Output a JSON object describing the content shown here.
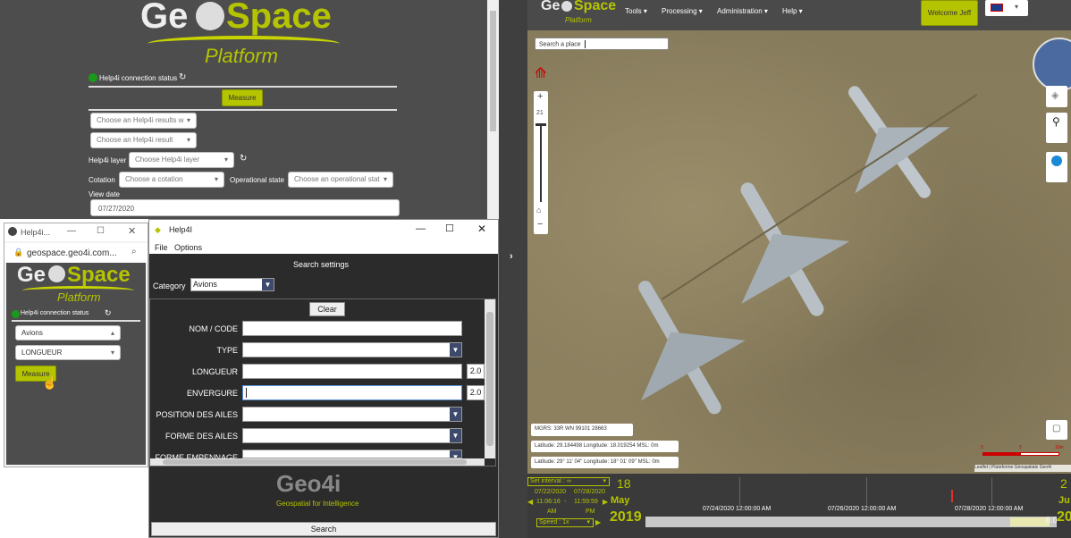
{
  "left_panel": {
    "logo_geo": "Ge",
    "logo_space": "Space",
    "logo_platform": "Platform",
    "connection_status": "Help4i connection status",
    "measure_label": "Measure",
    "results_select": "Choose an Help4i results w",
    "result_select": "Choose an Help4i result",
    "layer_label": "Help4i layer",
    "layer_select": "Choose Help4i layer",
    "cotation_label": "Cotation",
    "cotation_select": "Choose a cotation",
    "op_state_label": "Operational state",
    "op_state_select": "Choose an operational stat",
    "view_date_label": "View date",
    "view_date_value": "07/27/2020"
  },
  "browser_popup": {
    "tab_title": "Help4i...",
    "url": "geospace.geo4i.com...",
    "logo_geo": "Ge",
    "logo_space": "Space",
    "logo_platform": "Platform",
    "connection_status": "Help4i connection status",
    "category_select": "Avions",
    "field_select": "LONGUEUR",
    "measure_label": "Measure"
  },
  "help4i_window": {
    "title": "Help4I",
    "menu_file": "File",
    "menu_options": "Options",
    "search_settings": "Search settings",
    "category_label": "Category",
    "category_value": "Avions",
    "clear_label": "Clear",
    "fields": [
      {
        "label": "NOM / CODE",
        "kind": "text",
        "value": ""
      },
      {
        "label": "TYPE",
        "kind": "combo",
        "value": ""
      },
      {
        "label": "LONGUEUR",
        "kind": "text",
        "value": "",
        "tolerance": "2.0"
      },
      {
        "label": "ENVERGURE",
        "kind": "text",
        "value": "",
        "tolerance": "2.0"
      },
      {
        "label": "POSITION DES AILES",
        "kind": "combo",
        "value": ""
      },
      {
        "label": "FORME DES AILES",
        "kind": "combo",
        "value": ""
      },
      {
        "label": "FORME EMPENNAGE",
        "kind": "combo",
        "value": ""
      }
    ],
    "footer_logo": "Geo4i",
    "footer_tagline": "Geospatial for Intelligence",
    "search_label": "Search"
  },
  "top_nav": {
    "logo_geo": "Ge",
    "logo_space": "Space",
    "logo_platform": "Platform",
    "menu": [
      "Tools",
      "Processing",
      "Administration",
      "Help"
    ],
    "welcome": "Welcome Jeff"
  },
  "map": {
    "search_placeholder": "Search a place",
    "zoom_in": "+",
    "zoom_level": "21",
    "zoom_out": "−",
    "mgrs": "MGRS:  33R WN 99101 28663",
    "latlon_decimal": "Latitude: 29.184498 Longitude: 18.019254 MSL: 0m",
    "latlon_dms": "Latitude: 29° 11' 04'' Longitude: 18° 01' 09'' MSL: 0m",
    "scale_labels": [
      "0",
      "5",
      "10m"
    ],
    "attribution": "Leaflet | Plateforme Géospatiale Geo4i"
  },
  "timeline": {
    "interval": "Set interval : ∞",
    "start_date": "07/22/2020",
    "end_date": "07/28/2020",
    "start_time": "11:06:16",
    "end_time": "11:59:59",
    "am": "AM",
    "pm": "PM",
    "speed": "Speed : 1x",
    "day": "18",
    "month": "May",
    "year": "2019",
    "right_day": "2",
    "right_month": "Ju",
    "right_year": "20",
    "ticks": [
      "07/24/2020 12:00:00 AM",
      "07/26/2020 12:00:00 AM",
      "07/28/2020 12:00:00 AM"
    ],
    "counter": "0.0"
  },
  "colors": {
    "accent": "#b5c400",
    "panel_bg": "#4a4a4a",
    "dialog_bg": "#2b2b2b"
  }
}
